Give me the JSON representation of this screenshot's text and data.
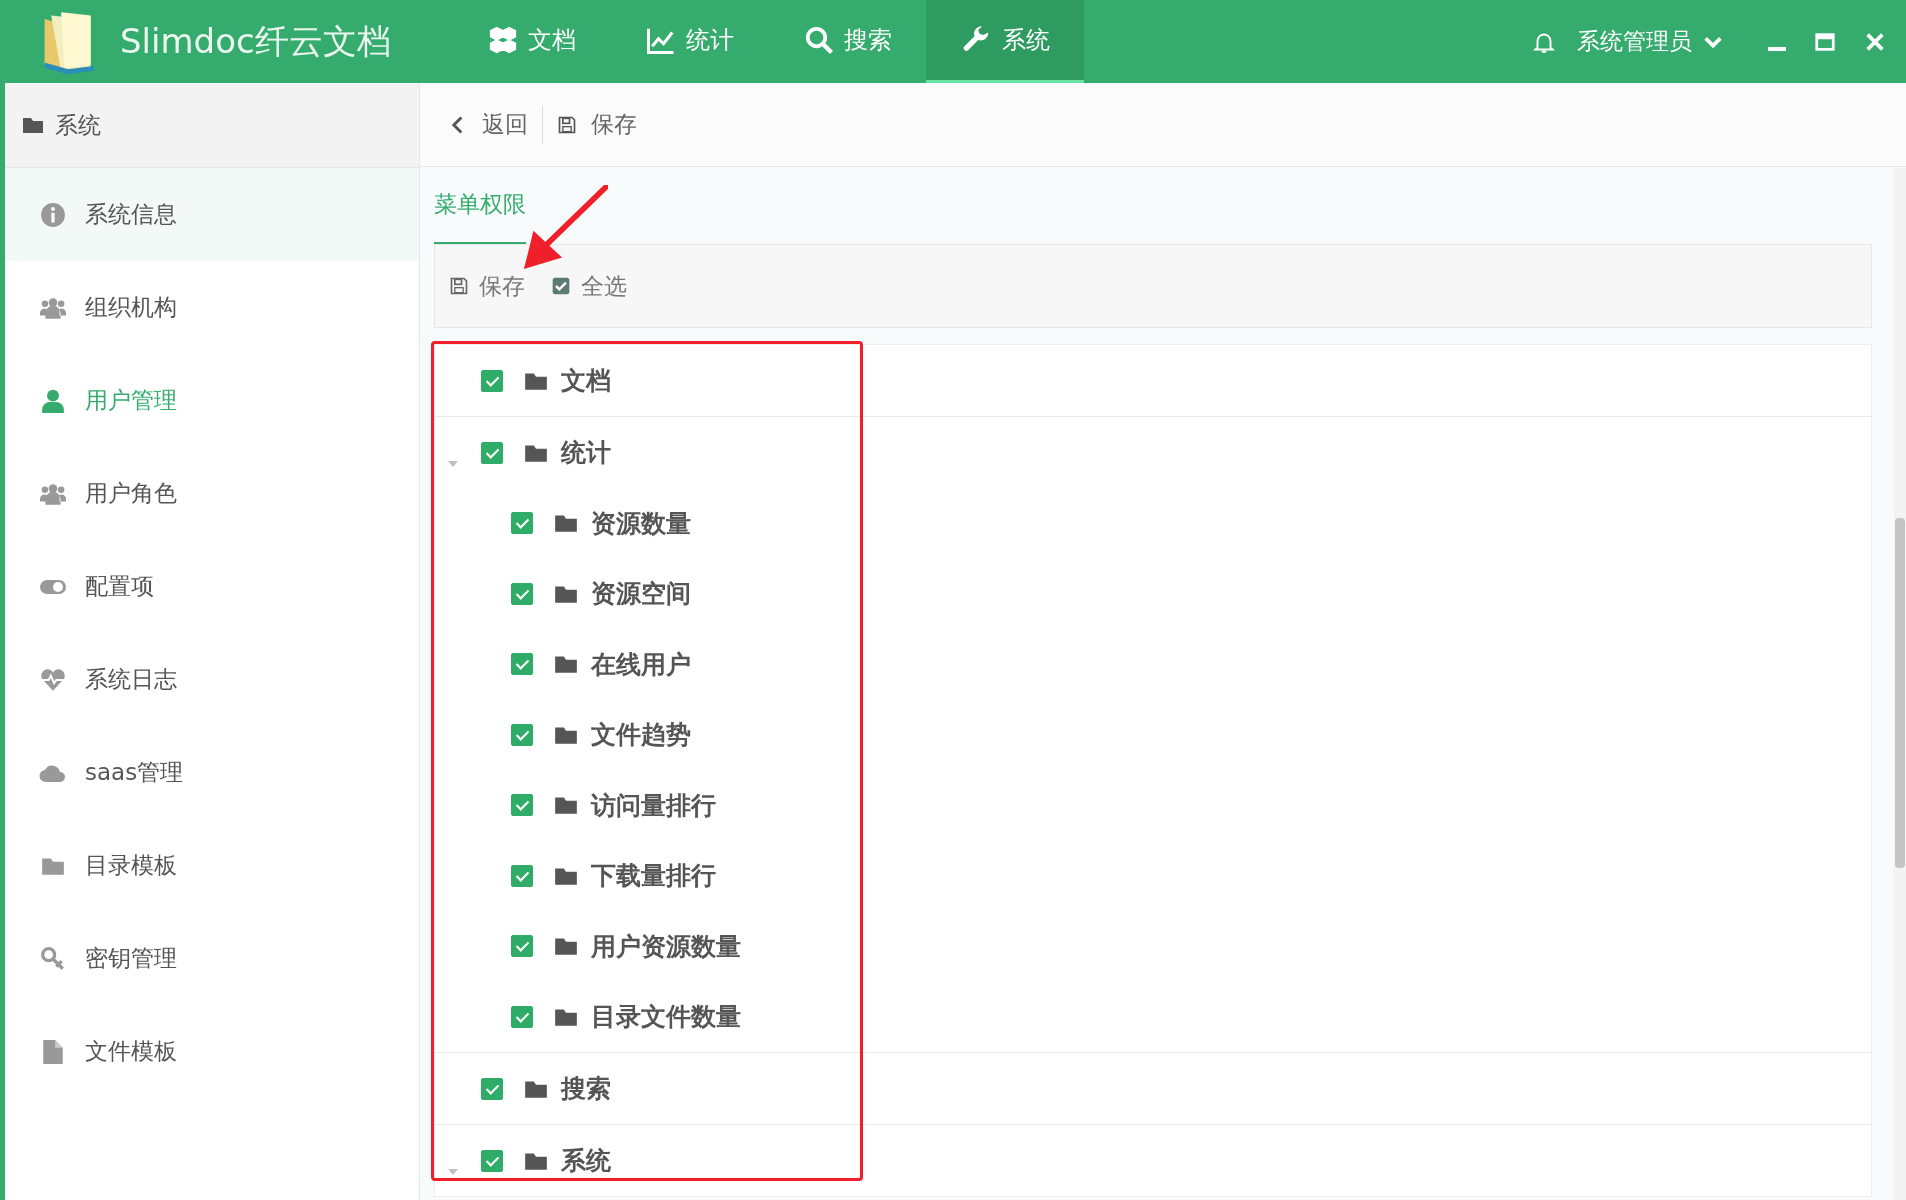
{
  "app": {
    "title": "Slimdoc纤云文档"
  },
  "nav": [
    {
      "label": "文档",
      "selected": false
    },
    {
      "label": "统计",
      "selected": false
    },
    {
      "label": "搜索",
      "selected": false
    },
    {
      "label": "系统",
      "selected": true
    }
  ],
  "user": {
    "name": "系统管理员"
  },
  "sidebar": {
    "title": "系统",
    "items": [
      {
        "label": "系统信息",
        "selected": false,
        "hovered": true
      },
      {
        "label": "组织机构",
        "selected": false,
        "hovered": false
      },
      {
        "label": "用户管理",
        "selected": true,
        "hovered": false
      },
      {
        "label": "用户角色",
        "selected": false,
        "hovered": false
      },
      {
        "label": "配置项",
        "selected": false,
        "hovered": false
      },
      {
        "label": "系统日志",
        "selected": false,
        "hovered": false
      },
      {
        "label": "saas管理",
        "selected": false,
        "hovered": false
      },
      {
        "label": "目录模板",
        "selected": false,
        "hovered": false
      },
      {
        "label": "密钥管理",
        "selected": false,
        "hovered": false
      },
      {
        "label": "文件模板",
        "selected": false,
        "hovered": false
      }
    ]
  },
  "toolbar": {
    "back": "返回",
    "save": "保存"
  },
  "tabs": [
    {
      "label": "菜单权限",
      "selected": true
    }
  ],
  "panel_toolbar": {
    "save": "保存",
    "select_all": "全选"
  },
  "tree": [
    {
      "label": "文档",
      "checked": true
    },
    {
      "label": "统计",
      "checked": true,
      "expanded": true,
      "children": [
        {
          "label": "资源数量",
          "checked": true
        },
        {
          "label": "资源空间",
          "checked": true
        },
        {
          "label": "在线用户",
          "checked": true
        },
        {
          "label": "文件趋势",
          "checked": true
        },
        {
          "label": "访问量排行",
          "checked": true
        },
        {
          "label": "下载量排行",
          "checked": true
        },
        {
          "label": "用户资源数量",
          "checked": true
        },
        {
          "label": "目录文件数量",
          "checked": true
        }
      ]
    },
    {
      "label": "搜索",
      "checked": true
    },
    {
      "label": "系统",
      "checked": true,
      "expanded": true
    }
  ],
  "annotations": {
    "highlight_box": true,
    "arrow": true
  }
}
